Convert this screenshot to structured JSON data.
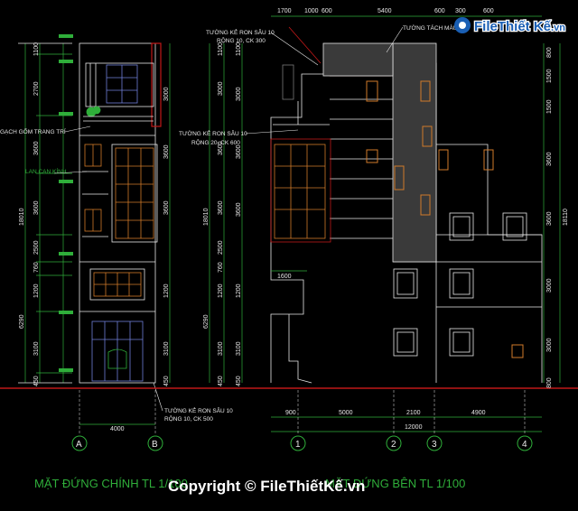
{
  "logo": {
    "part1": "File",
    "part2": "Thiết Kế",
    "part3": ".vn"
  },
  "left_elevation": {
    "caption": "MẶT ĐỨNG CHÍNH TL 1/100",
    "dim_left_total": "18010",
    "dim_left_segments": [
      "1100",
      "2700",
      "3600",
      "3600",
      "2500",
      "760",
      "1200",
      "3100",
      "450"
    ],
    "dim_left_group": "6290",
    "dim_right_segments": [
      "3000",
      "3600",
      "3600",
      "1200",
      "3100",
      "450"
    ],
    "dim_bottom": "4000",
    "notes": {
      "tile": "GẠCH GỐM TRANG TRÍ",
      "glass": "LAN CAN KÍNH",
      "groove_bottom_l1": "TƯỜNG KẺ RON SÂU 10",
      "groove_bottom_l2": "RỘNG 10, CK 500"
    },
    "axes": [
      "A",
      "B"
    ]
  },
  "right_elevation": {
    "caption": "MẶT ĐỨNG BÊN TL 1/100",
    "dim_top": [
      "1700",
      "1000",
      "600",
      "5400",
      "600",
      "300",
      "600"
    ],
    "dim_left_total": "18010",
    "dim_left_segments": [
      "1100",
      "3000",
      "3600",
      "3600",
      "2500",
      "760",
      "1200",
      "3100",
      "450"
    ],
    "dim_left_group": "6290",
    "dim_right_total": "18110",
    "dim_right_segments": [
      "800",
      "1500",
      "1500",
      "3600",
      "3600",
      "3000",
      "3000",
      "800"
    ],
    "dim_bottom": [
      "900",
      "5000",
      "2100",
      "4900"
    ],
    "dim_bottom_total": "12000",
    "dim_mid": "1600",
    "notes": {
      "groove_top_l1": "TƯỜNG KẺ RON SÂU 10",
      "groove_top_l2": "RỘNG 10, CK 300",
      "groove_mid_l1": "TƯỜNG KẺ RON SÂU 10",
      "groove_mid_l2": "RỘNG 20, CK 600",
      "wall": "TƯỜNG TÁCH MÀU"
    },
    "axes": [
      "1",
      "2",
      "3",
      "4"
    ]
  },
  "watermark": "Copyright © FileThiếtKế.vn",
  "colors": {
    "background": "#000000",
    "line": "#e8e8e8",
    "dim_green": "#2fae3a",
    "window_orange": "#d07a2a",
    "red_line": "#c01818",
    "blue_door": "#6f7fd8",
    "logo_blue": "#1a5fb4"
  }
}
